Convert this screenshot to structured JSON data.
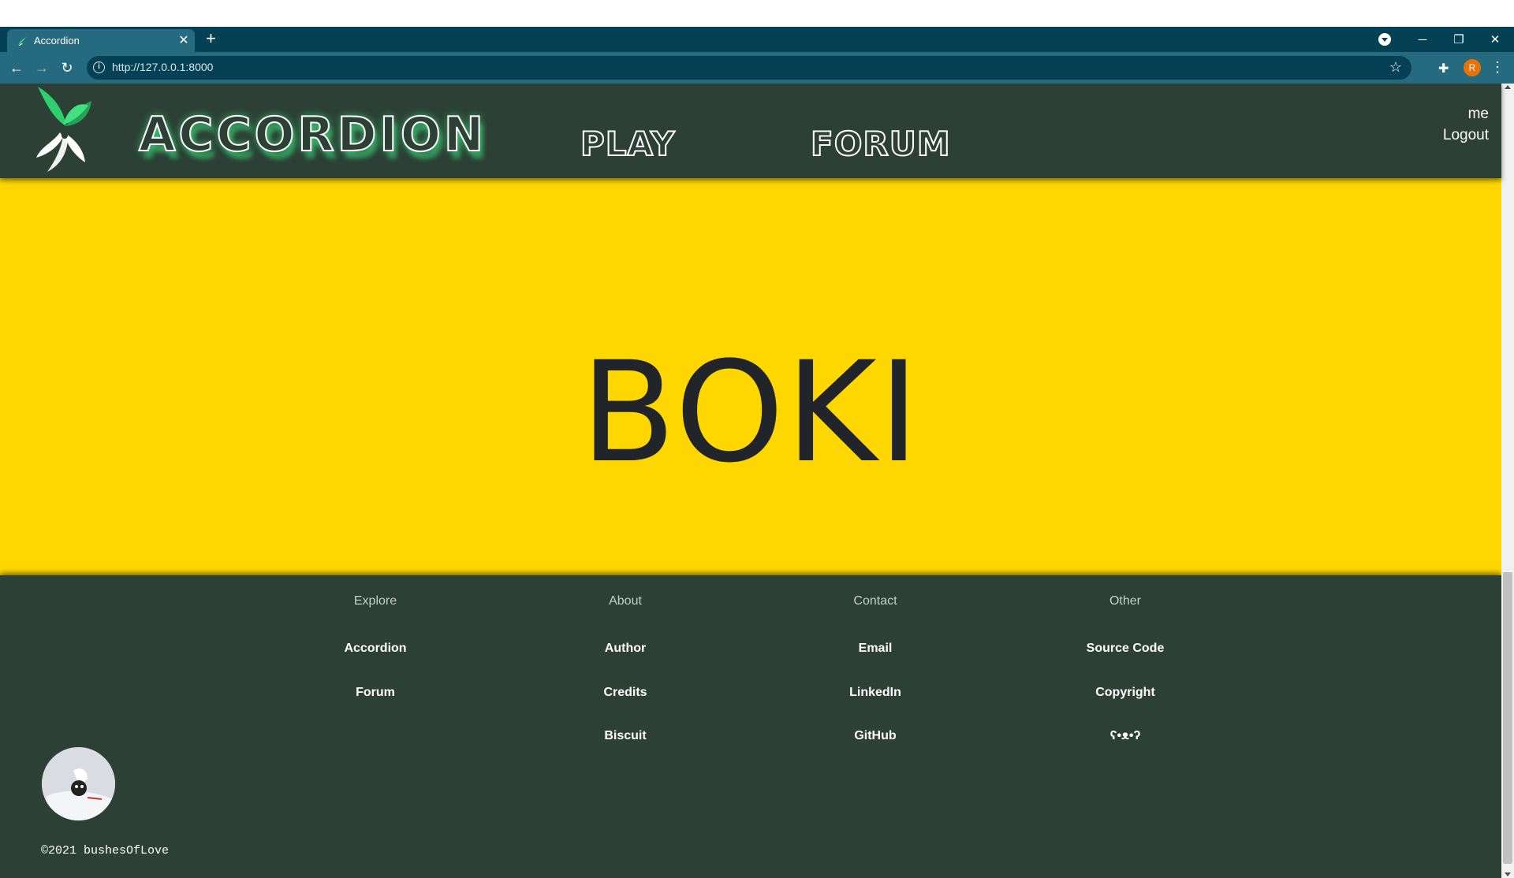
{
  "browser": {
    "tab_title": "Accordion",
    "tab_close": "✕",
    "new_tab": "+",
    "url": "http://127.0.0.1:8000",
    "profile_initial": "R",
    "minimize": "─",
    "restore": "❐",
    "close": "✕"
  },
  "header": {
    "brand": "ACCORDION",
    "nav": [
      "PLAY",
      "FORUM"
    ],
    "user": "me",
    "logout": "Logout"
  },
  "hero": {
    "text": "BOKI"
  },
  "footer": {
    "columns": [
      {
        "heading": "Explore",
        "links": [
          "Accordion",
          "Forum"
        ]
      },
      {
        "heading": "About",
        "links": [
          "Author",
          "Credits",
          "Biscuit"
        ]
      },
      {
        "heading": "Contact",
        "links": [
          "Email",
          "LinkedIn",
          "GitHub"
        ]
      },
      {
        "heading": "Other",
        "links": [
          "Source Code",
          "Copyright",
          "ʕ•ᴥ•ʔ"
        ]
      }
    ],
    "copyright": "©2021 bushesOfLove"
  },
  "colors": {
    "chrome_dark": "#054155",
    "chrome_light": "#256a7e",
    "header_bg": "#2c4036",
    "hero_bg": "#fed700",
    "hero_text": "#212529",
    "brand_glow": "#3dd677"
  },
  "icons": [
    "favicon-icon",
    "back-icon",
    "forward-icon",
    "reload-icon",
    "info-icon",
    "star-icon",
    "extensions-icon",
    "menu-icon",
    "logo-icon",
    "avatar-icon"
  ]
}
